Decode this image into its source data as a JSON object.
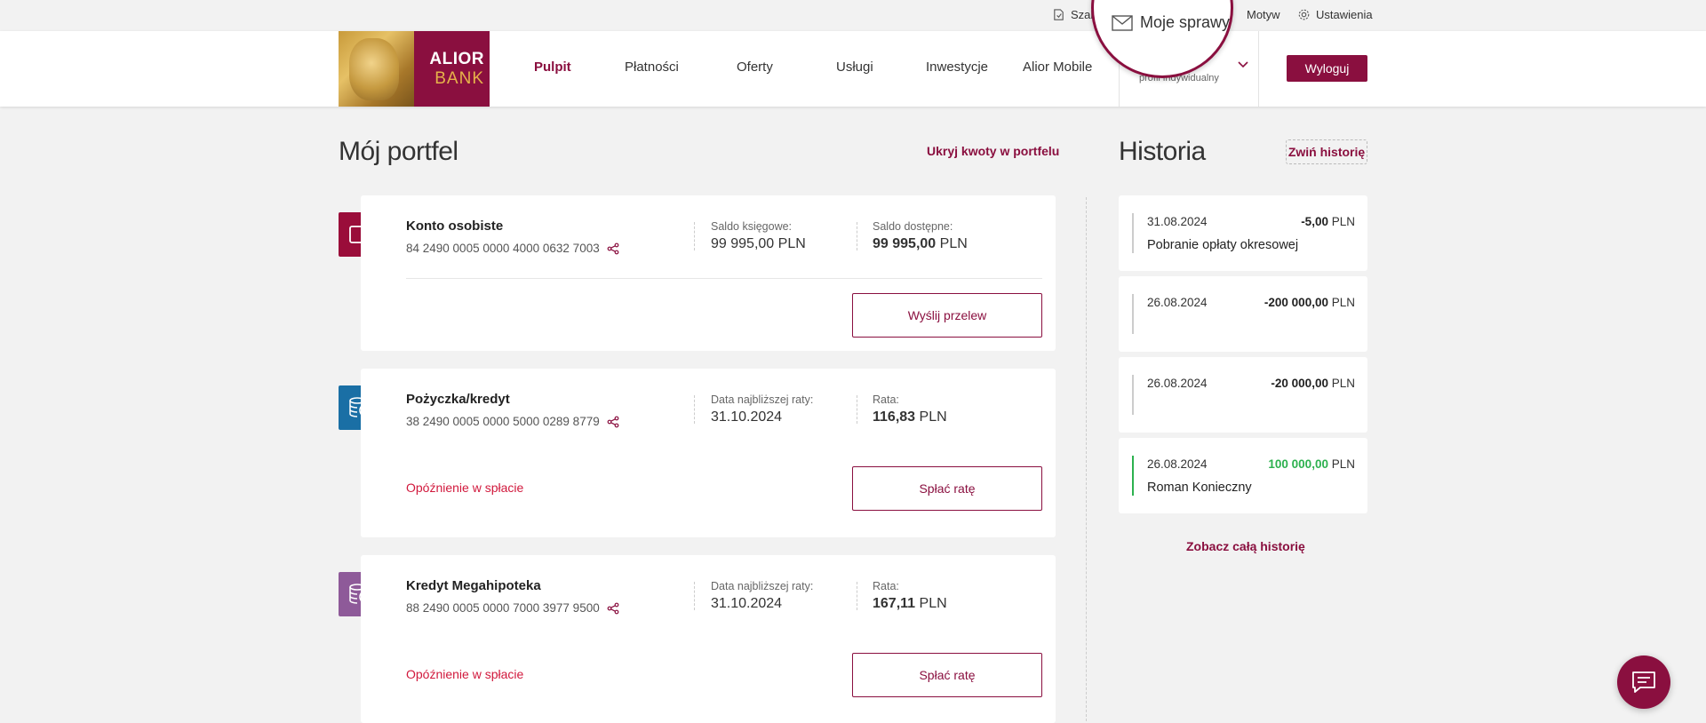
{
  "utility": {
    "templates_label": "Szab",
    "theme_label": "Motyw",
    "settings_label": "Ustawienia"
  },
  "magnifier": {
    "label": "Moje sprawy"
  },
  "brand": {
    "line1": "ALIOR",
    "line2": "BANK"
  },
  "nav": [
    {
      "label": "Pulpit",
      "active": true
    },
    {
      "label": "Płatności"
    },
    {
      "label": "Oferty"
    },
    {
      "label": "Usługi"
    },
    {
      "label": "Inwestycje"
    },
    {
      "label": "Alior Mobile"
    }
  ],
  "profile": {
    "subtitle": "profil indywidualny"
  },
  "logout_label": "Wyloguj",
  "portfolio": {
    "title": "Mój portfel",
    "hide_amounts_label": "Ukryj kwoty w portfelu",
    "products": [
      {
        "name": "Konto osobiste",
        "account": "84 2490 0005 0000 4000 0632 7003",
        "label1": "Saldo księgowe:",
        "value1": "99 995,00",
        "value1_bold": false,
        "label2": "Saldo dostępne:",
        "value2": "99 995,00",
        "currency": "PLN",
        "action": "Wyślij przelew",
        "icon": "wallet-icon",
        "color": "#9a0d3a",
        "alert": false
      },
      {
        "name": "Pożyczka/kredyt",
        "account": "38 2490 0005 0000 5000 0289 8779",
        "label1": "Data najbliższej raty:",
        "value1": "31.10.2024",
        "label2": "Rata:",
        "value2": "116,83",
        "currency": "PLN",
        "status": "Opóźnienie w spłacie",
        "action": "Spłać ratę",
        "icon": "coins-icon",
        "color": "#1a6fa5",
        "alert": true
      },
      {
        "name": "Kredyt Megahipoteka",
        "account": "88 2490 0005 0000 7000 3977 9500",
        "label1": "Data najbliższej raty:",
        "value1": "31.10.2024",
        "label2": "Rata:",
        "value2": "167,11",
        "currency": "PLN",
        "status": "Opóźnienie w spłacie",
        "action": "Spłać ratę",
        "icon": "coins-icon",
        "color": "#8e5a99",
        "alert": true
      }
    ]
  },
  "history": {
    "title": "Historia",
    "collapse_label": "Zwiń historię",
    "see_all_label": "Zobacz całą historię",
    "items": [
      {
        "date": "31.08.2024",
        "amount": "-5,00",
        "currency": "PLN",
        "description": "Pobranie opłaty okresowej",
        "positive": false
      },
      {
        "date": "26.08.2024",
        "amount": "-200 000,00",
        "currency": "PLN",
        "description": "",
        "positive": false
      },
      {
        "date": "26.08.2024",
        "amount": "-20 000,00",
        "currency": "PLN",
        "description": "",
        "positive": false
      },
      {
        "date": "26.08.2024",
        "amount": "100 000,00",
        "currency": "PLN",
        "description": "Roman Konieczny",
        "positive": true
      }
    ]
  },
  "colors": {
    "brand": "#8a0f3f",
    "alert": "#d1183c",
    "positive": "#2db14f"
  }
}
